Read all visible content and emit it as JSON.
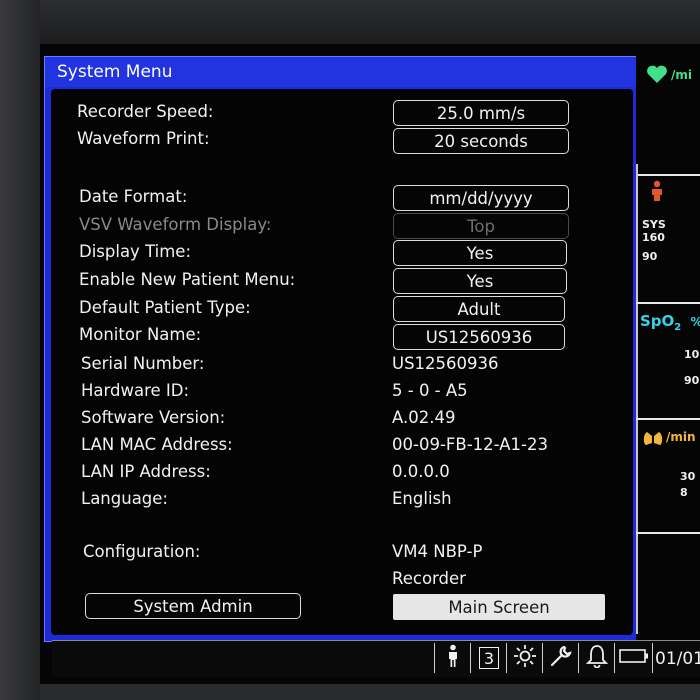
{
  "menu": {
    "title": "System Menu",
    "fields": [
      {
        "label": "Recorder Speed:",
        "value": "25.0 mm/s",
        "kind": "button"
      },
      {
        "label": "Waveform Print:",
        "value": "20 seconds",
        "kind": "button"
      },
      {
        "label": "Date Format:",
        "value": "mm/dd/yyyy",
        "kind": "button"
      },
      {
        "label": "VSV Waveform Display:",
        "value": "Top",
        "kind": "disabled-button"
      },
      {
        "label": "Display Time:",
        "value": "Yes",
        "kind": "button"
      },
      {
        "label": "Enable New Patient Menu:",
        "value": "Yes",
        "kind": "button"
      },
      {
        "label": "Default Patient Type:",
        "value": "Adult",
        "kind": "button"
      },
      {
        "label": "Monitor Name:",
        "value": "US12560936",
        "kind": "button"
      },
      {
        "label": "Serial Number:",
        "value": "US12560936",
        "kind": "text"
      },
      {
        "label": "Hardware ID:",
        "value": "5 - 0 - A5",
        "kind": "text"
      },
      {
        "label": "Software Version:",
        "value": "A.02.49",
        "kind": "text"
      },
      {
        "label": "LAN MAC Address:",
        "value": "00-09-FB-12-A1-23",
        "kind": "text"
      },
      {
        "label": "LAN IP Address:",
        "value": "0.0.0.0",
        "kind": "text"
      },
      {
        "label": "Language:",
        "value": "English",
        "kind": "text"
      },
      {
        "label": "Configuration:",
        "value": "VM4 NBP-P",
        "kind": "text"
      },
      {
        "label": "",
        "value": "Recorder",
        "kind": "text"
      }
    ],
    "system_admin_label": "System Admin",
    "main_screen_label": "Main Screen"
  },
  "side_panel": {
    "hr_unit": "/mi",
    "nbp_label": "SYS",
    "nbp_sys": "160",
    "nbp_dia": "90",
    "spo2_label": "SpO",
    "spo2_sub": "2",
    "spo2_unit": "%",
    "spo2_high": "10",
    "spo2_low": "90",
    "resp_unit": "/min",
    "resp_high": "30",
    "resp_low": "8"
  },
  "status_bar": {
    "patient_icon": "patient-icon",
    "recorder_value": "3",
    "brightness_icon": "brightness-icon",
    "tools_icon": "wrench-icon",
    "alarm_icon": "bell-icon",
    "battery_icon": "battery-icon",
    "date_text": "01/01"
  },
  "colors": {
    "menu_blue": "#1f2bd8",
    "spo2_cyan": "#35d3e8",
    "heart_green": "#42e08a",
    "resp_amber": "#f2b640"
  }
}
